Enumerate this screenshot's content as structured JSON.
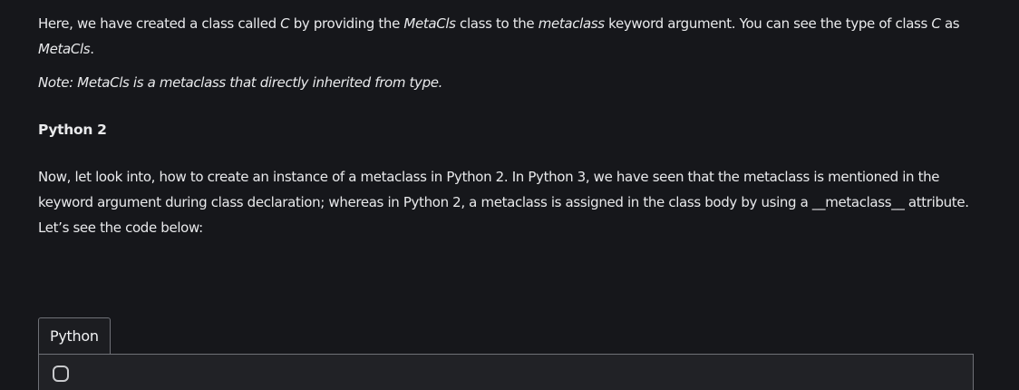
{
  "article": {
    "p1": {
      "t1": "Here, we have created a class called ",
      "t2": "C",
      "t3": " by providing the ",
      "t4": "MetaCls",
      "t5": " class to the ",
      "t6": "metaclass",
      "t7": " keyword argument.  You can see the type of class ",
      "t8": "C",
      "t9": " as ",
      "t10": "MetaCls",
      "t11": "."
    },
    "note": "Note: MetaCls is a metaclass that directly inherited from type.",
    "section_title": "Python 2",
    "p3": {
      "t1": "Now, let look into, how to create an instance of a metaclass in Python 2. In Python 3, we have seen that the metaclass is mentioned in the keyword argument during class declaration; whereas in Python 2, a metaclass is assigned in the class body by using a ",
      "t2": "__metaclass__",
      "t3": " attribute. Let’s see the code below:"
    }
  },
  "code_block": {
    "tab_label": "Python"
  }
}
